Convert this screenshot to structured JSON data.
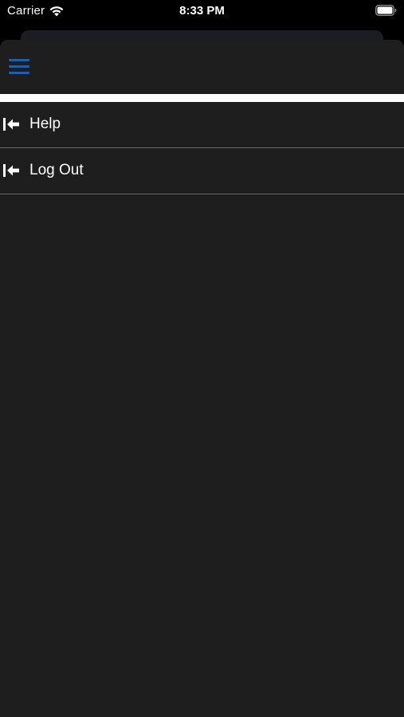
{
  "status_bar": {
    "carrier": "Carrier",
    "time": "8:33 PM"
  },
  "nav": {
    "menu_icon": "hamburger-menu-icon",
    "accent_color": "#1f5fa8"
  },
  "menu": {
    "items": [
      {
        "label": "Help",
        "icon": "arrow-left-to-bar-icon"
      },
      {
        "label": "Log Out",
        "icon": "arrow-left-to-bar-icon"
      }
    ]
  },
  "colors": {
    "background": "#1e1e1e",
    "divider": "#6a6a6a",
    "text": "#ffffff"
  }
}
